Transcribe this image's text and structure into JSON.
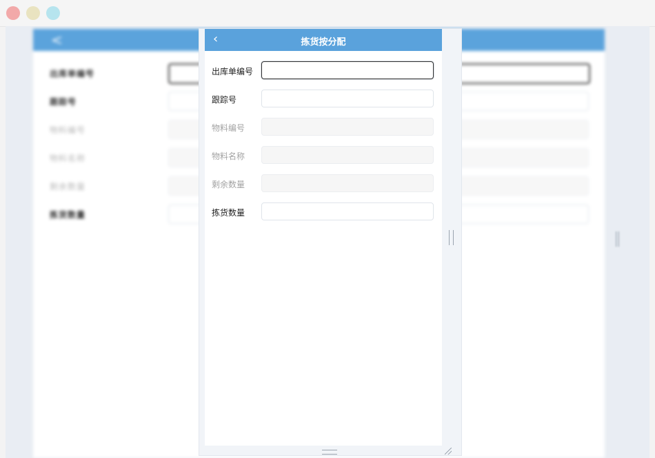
{
  "window": {
    "controls": [
      "close",
      "minimize",
      "maximize"
    ]
  },
  "dialog": {
    "title": "拣货按分配",
    "back_icon": "‹",
    "fields": [
      {
        "label": "出库单编号",
        "value": "",
        "enabled": true,
        "focused": true
      },
      {
        "label": "跟踪号",
        "value": "",
        "enabled": true,
        "focused": false
      },
      {
        "label": "物料编号",
        "value": "",
        "enabled": false,
        "focused": false
      },
      {
        "label": "物料名称",
        "value": "",
        "enabled": false,
        "focused": false
      },
      {
        "label": "剩余数量",
        "value": "",
        "enabled": false,
        "focused": false
      },
      {
        "label": "拣货数量",
        "value": "",
        "enabled": true,
        "focused": false
      }
    ]
  },
  "background_app": {
    "back_icon": "<",
    "fields": [
      {
        "label": "出库单编号"
      },
      {
        "label": "跟踪号"
      },
      {
        "label": "物料编号"
      },
      {
        "label": "物料名称"
      },
      {
        "label": "剩余数量"
      },
      {
        "label": "拣货数量"
      }
    ]
  },
  "colors": {
    "header": "#5aa2dc",
    "label": "#222222",
    "label_disabled": "#a3a3a3"
  }
}
